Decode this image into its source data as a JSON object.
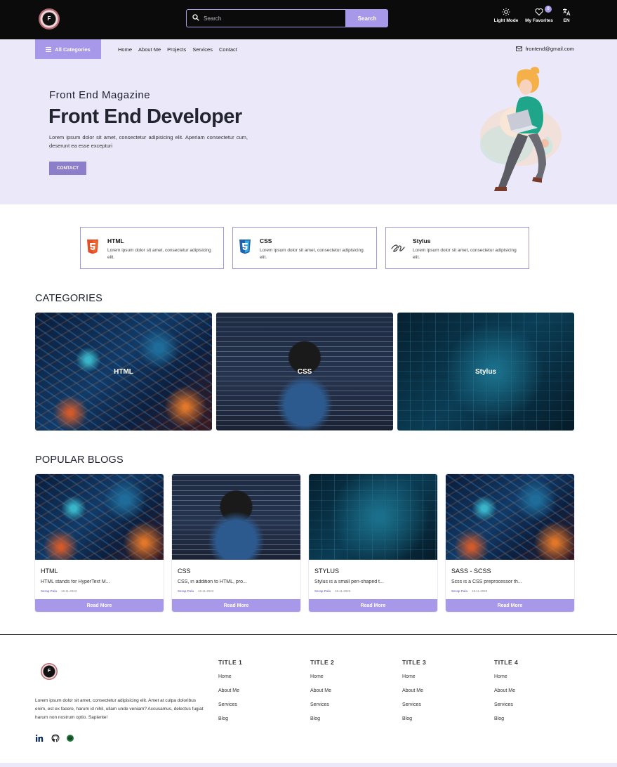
{
  "header": {
    "logo_letter": "F",
    "search_placeholder": "Search",
    "search_button": "Search",
    "light_mode": "Light Mode",
    "favorites": "My Favorites",
    "favorites_count": "0",
    "language": "EN"
  },
  "nav": {
    "categories_button": "All Categories",
    "links": [
      "Home",
      "About Me",
      "Projects",
      "Services",
      "Contact"
    ],
    "email": "frontend@gmail.com"
  },
  "hero": {
    "subtitle": "Front End Magazine",
    "title": "Front End Developer",
    "text": "Lorem ipsum dolor sit amet, consectetur adipisicing elit. Aperiam consectetur cum, deserunt ea esse excepturi",
    "button": "CONTACT"
  },
  "skills": [
    {
      "name": "HTML",
      "desc": "Lorem ipsum dolor sit amet, consectetur adipisicing elit.",
      "icon": "html5-icon",
      "color": "#e44d26"
    },
    {
      "name": "CSS",
      "desc": "Lorem ipsum dolor sit amet, consectetur adipisicing elit.",
      "icon": "css3-icon",
      "color": "#1f62ad"
    },
    {
      "name": "Stylus",
      "desc": "Lorem ipsum dolor sit amet, consectetur adipisicing elit.",
      "icon": "stylus-icon",
      "color": "#333333"
    }
  ],
  "categories": {
    "heading": "CATEGORIES",
    "items": [
      "HTML",
      "CSS",
      "Stylus"
    ]
  },
  "blogs": {
    "heading": "POPULAR BLOGS",
    "read_more": "Read More",
    "items": [
      {
        "title": "HTML",
        "excerpt": "HTML stands for HyperText M...",
        "author": "Serap Pala",
        "date": "19.11.2023"
      },
      {
        "title": "CSS",
        "excerpt": "CSS, in addition to HTML, pro...",
        "author": "Serap Pala",
        "date": "19.11.2023"
      },
      {
        "title": "STYLUS",
        "excerpt": "Stylus is a small pen-shaped t...",
        "author": "Serap Pala",
        "date": "19.11.2023"
      },
      {
        "title": "SASS - SCSS",
        "excerpt": "Scss is a CSS preprocessor th...",
        "author": "Serap Pala",
        "date": "19.11.2023"
      }
    ]
  },
  "footer": {
    "logo_letter": "F",
    "text": "Lorem ipsum dolor sit amet, consectetur adipisicing elit. Amet at culpa doloribus enim, est ex facere, harum id nihil, ullam unde veniam? Accusamus, delectus fugiat harum non nostrum optio. Sapiente!",
    "columns": [
      {
        "title": "TITLE 1",
        "links": [
          "Home",
          "About Me",
          "Services",
          "Blog"
        ]
      },
      {
        "title": "TITLE 2",
        "links": [
          "Home",
          "About Me",
          "Services",
          "Blog"
        ]
      },
      {
        "title": "TITLE 3",
        "links": [
          "Home",
          "About Me",
          "Services",
          "Blog"
        ]
      },
      {
        "title": "TITLE 4",
        "links": [
          "Home",
          "About Me",
          "Services",
          "Blog"
        ]
      }
    ],
    "social_icons": [
      "linkedin-icon",
      "github-icon",
      "spotify-icon"
    ]
  },
  "colors": {
    "accent": "#a798ea",
    "hero_bg": "#ebe9f9",
    "topbar": "#0b0b0b"
  }
}
